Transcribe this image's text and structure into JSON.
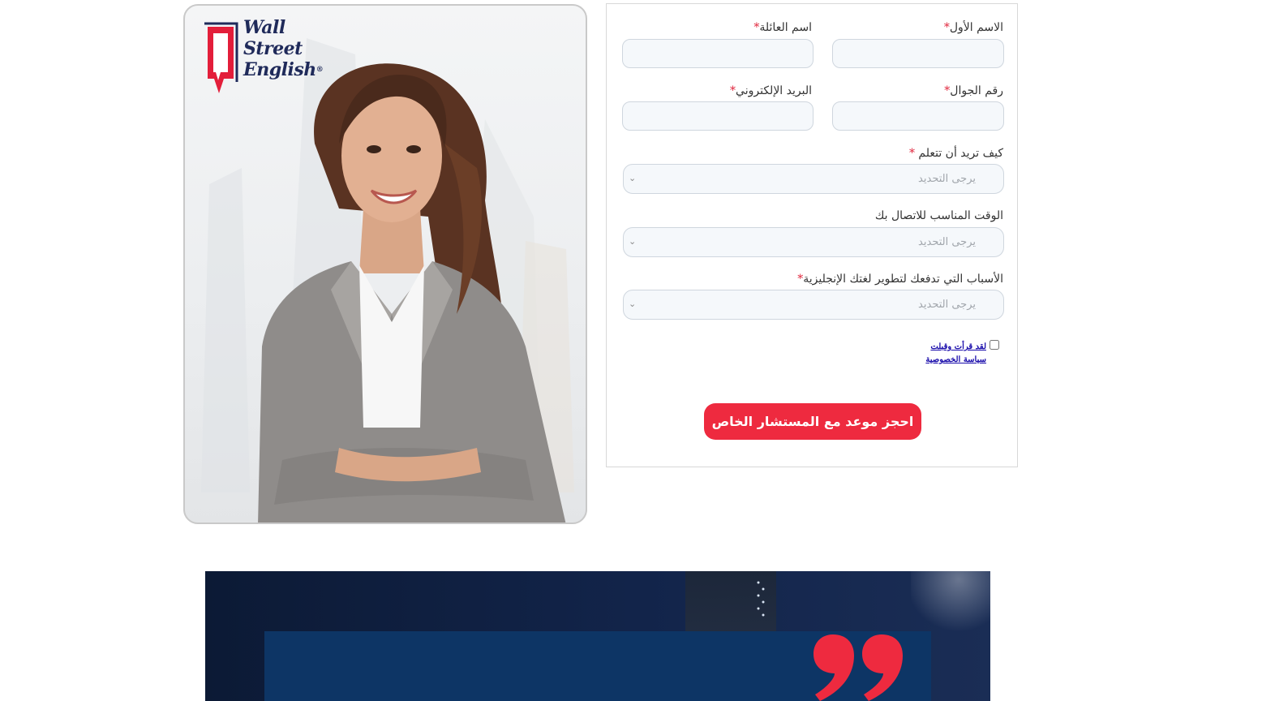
{
  "brand": {
    "logo_lines": [
      "Wall",
      "Street",
      "English"
    ],
    "logo_reg": "®"
  },
  "form": {
    "first_name_label": "الاسم الأول",
    "last_name_label": "اسم العائلة",
    "mobile_label": "رقم الجوال",
    "email_label": "البريد الإلكتروني",
    "learn_label": "كيف تريد أن تتعلم",
    "contact_time_label": "الوقت المناسب للاتصال بك",
    "reasons_label": "الأسباب التي تدفعك لتطوير لغتك الإنجليزية",
    "required_mark": "*",
    "select_placeholder": "يرجى التحديد",
    "privacy_text": "لقد قرأت وقبلت سياسة الخصوصية",
    "submit_label": "احجز موعد مع المستشار الخاص"
  },
  "colors": {
    "accent": "#ee2a3f",
    "navy": "#1f2a5a",
    "banner_bg": "#0d3565"
  },
  "icons": {
    "select_arrow": "chevron-down-icon",
    "quote": "quote-icon"
  }
}
